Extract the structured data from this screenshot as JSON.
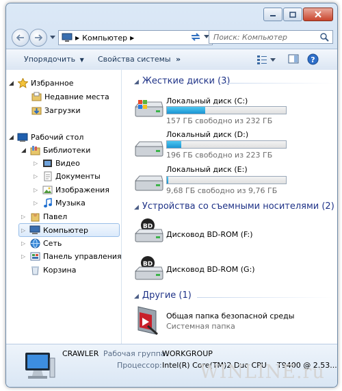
{
  "window": {
    "address_path": "Компьютер",
    "search_placeholder": "Поиск: Компьютер"
  },
  "toolbar": {
    "organize_label": "Упорядочить",
    "system_props_label": "Свойства системы",
    "more_label": "»"
  },
  "nav": {
    "favorites": "Избранное",
    "recent": "Недавние места",
    "downloads": "Загрузки",
    "desktop": "Рабочий стол",
    "libraries": "Библиотеки",
    "video": "Видео",
    "documents": "Документы",
    "images": "Изображения",
    "music": "Музыка",
    "user": "Павел",
    "computer": "Компьютер",
    "network": "Сеть",
    "control_panel": "Панель управления",
    "recycle_bin": "Корзина"
  },
  "content": {
    "hard_disks_header": "Жесткие диски (3)",
    "drives": [
      {
        "name": "Локальный диск (C:)",
        "free": "157 ГБ свободно из 232 ГБ",
        "used_fraction": 0.32
      },
      {
        "name": "Локальный диск (D:)",
        "free": "196 ГБ свободно из 223 ГБ",
        "used_fraction": 0.12
      },
      {
        "name": "Локальный диск (E:)",
        "free": "9,68 ГБ свободно из 9,76 ГБ",
        "used_fraction": 0.01
      }
    ],
    "removable_header": "Устройства со съемными носителями (2)",
    "removable": [
      {
        "name": "Дисковод BD-ROM (F:)",
        "icon_text": "BD"
      },
      {
        "name": "Дисковод BD-ROM (G:)",
        "icon_text": "BD"
      }
    ],
    "other_header": "Другие (1)",
    "other_items": [
      {
        "name": "Общая папка безопасной среды",
        "type": "Системная папка"
      }
    ]
  },
  "details": {
    "computer_name": "CRAWLER",
    "workgroup_label": "Рабочая группа:",
    "workgroup_value": "WORKGROUP",
    "processor_label": "Процессор:",
    "processor_value": "Intel(R) Core(TM)2 Duo CPU",
    "processor_extra": "T9400  @ 2.53..."
  },
  "watermark": "WINLINE.ru"
}
